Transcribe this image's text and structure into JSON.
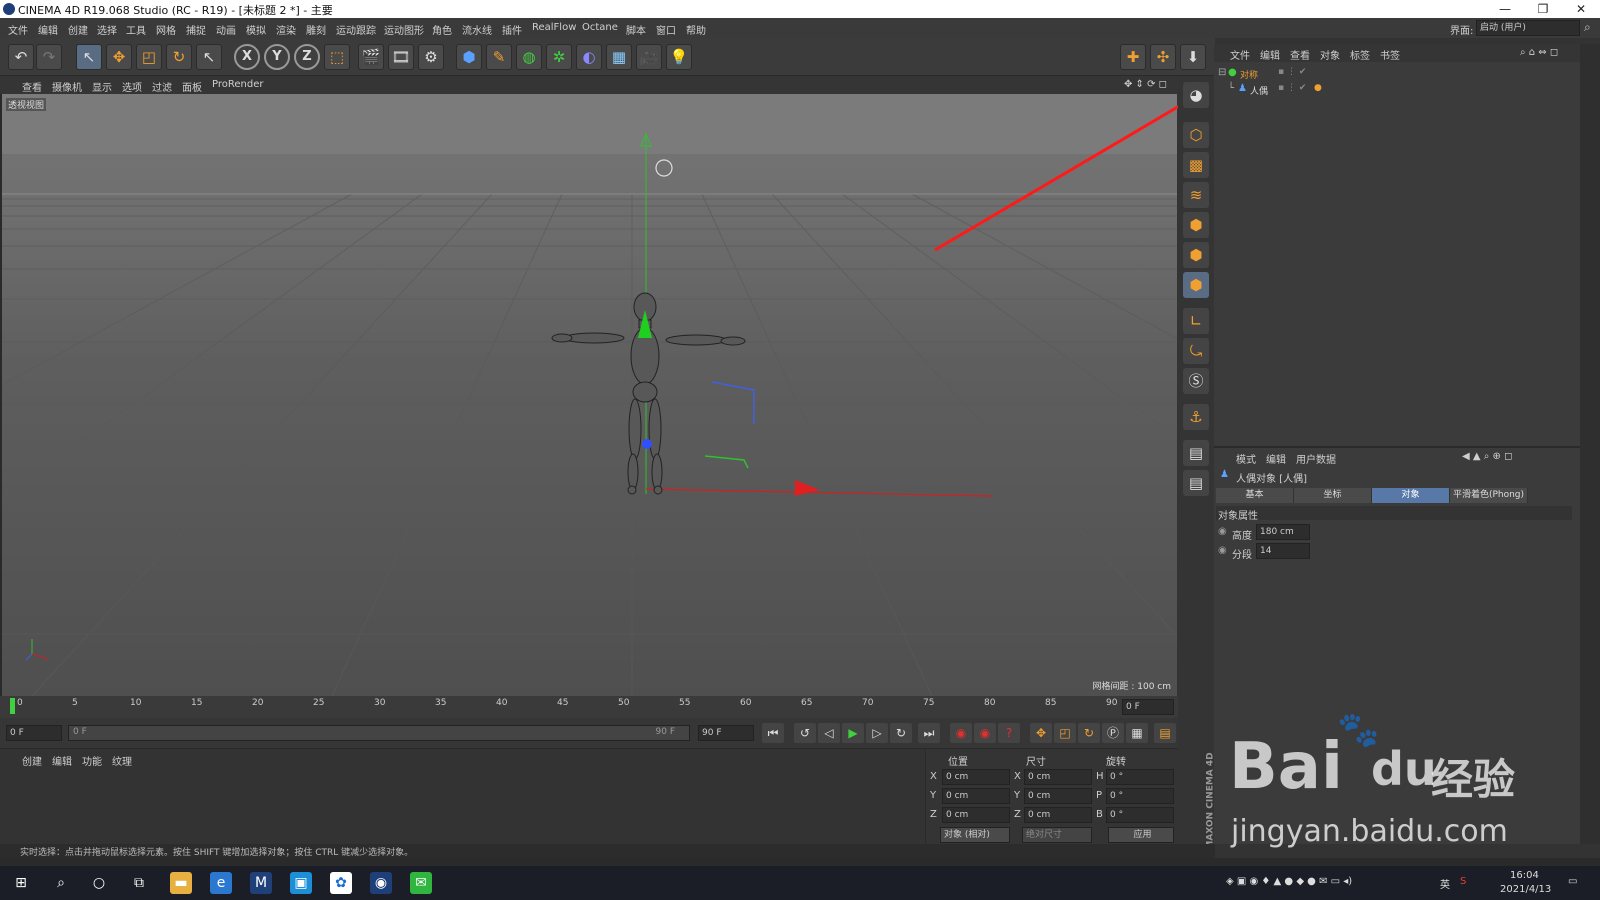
{
  "titlebar": {
    "title": "CINEMA 4D R19.068 Studio (RC - R19) - [未标题 2 *] - 主要"
  },
  "menubar": {
    "items": [
      "文件",
      "编辑",
      "创建",
      "选择",
      "工具",
      "网格",
      "捕捉",
      "动画",
      "模拟",
      "渲染",
      "雕刻",
      "运动跟踪",
      "运动图形",
      "角色",
      "流水线",
      "插件",
      "RealFlow",
      "Octane",
      "脚本",
      "窗口",
      "帮助"
    ],
    "layout_label": "界面:",
    "layout_value": "启动 (用户)"
  },
  "viewport_menu": {
    "items": [
      "查看",
      "摄像机",
      "显示",
      "选项",
      "过滤",
      "面板",
      "ProRender"
    ]
  },
  "viewport": {
    "label": "透视视图",
    "grid_spacing": "网格间距 : 100 cm"
  },
  "object_manager": {
    "tabs": [
      "文件",
      "编辑",
      "查看",
      "对象",
      "标签",
      "书签"
    ],
    "objects": [
      {
        "name": "对称"
      },
      {
        "name": "人偶"
      }
    ]
  },
  "attribute_manager": {
    "tabs": [
      "模式",
      "编辑",
      "用户数据"
    ],
    "object_title": "人偶对象 [人偶]",
    "sub_tabs": [
      "基本",
      "坐标",
      "对象",
      "平滑着色(Phong)"
    ],
    "section": "对象属性",
    "params": [
      {
        "label": "高度",
        "value": "180 cm"
      },
      {
        "label": "分段",
        "value": "14"
      }
    ]
  },
  "timeline": {
    "ticks": [
      "0",
      "5",
      "10",
      "15",
      "20",
      "25",
      "30",
      "35",
      "40",
      "45",
      "50",
      "55",
      "60",
      "65",
      "70",
      "75",
      "80",
      "85",
      "90"
    ],
    "current_frame": "0 F",
    "start_field": "0 F",
    "range_start": "0 F",
    "range_end": "90 F",
    "end_field": "90 F"
  },
  "material_panel": {
    "tabs": [
      "创建",
      "编辑",
      "功能",
      "纹理"
    ]
  },
  "coords": {
    "headers": [
      "位置",
      "尺寸",
      "旋转"
    ],
    "rows": [
      {
        "a": "X",
        "pos": "0 cm",
        "b": "X",
        "size": "0 cm",
        "c": "H",
        "rot": "0 °"
      },
      {
        "a": "Y",
        "pos": "0 cm",
        "b": "Y",
        "size": "0 cm",
        "c": "P",
        "rot": "0 °"
      },
      {
        "a": "Z",
        "pos": "0 cm",
        "b": "Z",
        "size": "0 cm",
        "c": "B",
        "rot": "0 °"
      }
    ],
    "mode": "对象 (相对)",
    "size_mode": "绝对尺寸",
    "apply": "应用"
  },
  "brand": "MAXON CINEMA 4D",
  "statusbar": {
    "text": "实时选择：点击并拖动鼠标选择元素。按住 SHIFT 键增加选择对象；按住 CTRL 键减少选择对象。"
  },
  "taskbar": {
    "time": "16:04",
    "date": "2021/4/13",
    "ime": "英"
  },
  "watermark": {
    "brand": "Bai",
    "du": "du",
    "jingyan": "经验",
    "url": "jingyan.baidu.com"
  },
  "colors": {
    "accent": "#5878a8",
    "arrow": "#ff1a1a",
    "axis_x": "#e02020",
    "axis_y": "#20c020",
    "axis_z": "#3050e0"
  }
}
